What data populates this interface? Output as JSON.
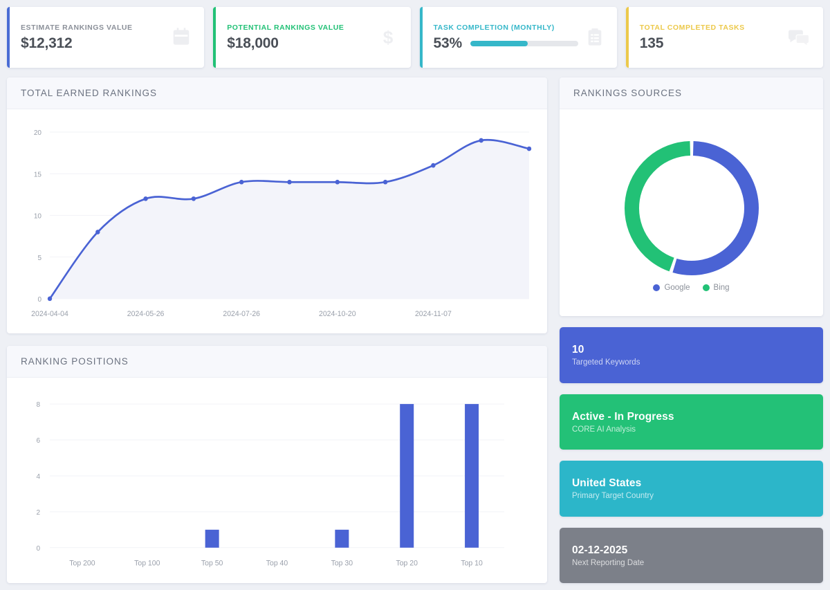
{
  "stats": [
    {
      "label": "ESTIMATE RANKINGS VALUE",
      "value": "$12,312",
      "accent": "#4a6cd4",
      "label_color": "#8b9099",
      "icon": "calendar-icon",
      "type": "value"
    },
    {
      "label": "POTENTIAL RANKINGS VALUE",
      "value": "$18,000",
      "accent": "#22c176",
      "label_color": "#22c176",
      "icon": "dollar-icon",
      "type": "value"
    },
    {
      "label": "TASK COMPLETION (MONTHLY)",
      "value": "53%",
      "accent": "#35b7c9",
      "label_color": "#35b7c9",
      "icon": "clipboard-icon",
      "type": "progress",
      "progress": 53
    },
    {
      "label": "TOTAL COMPLETED TASKS",
      "value": "135",
      "accent": "#ecc94b",
      "label_color": "#ecc94b",
      "icon": "comments-icon",
      "type": "value"
    }
  ],
  "panels": {
    "line_title": "TOTAL EARNED RANKINGS",
    "bar_title": "RANKING POSITIONS",
    "donut_title": "RANKINGS SOURCES"
  },
  "tiles": [
    {
      "value": "10",
      "label": "Targeted Keywords",
      "color": "#4a63d4"
    },
    {
      "value": "Active - In Progress",
      "label": "CORE AI Analysis",
      "color": "#23c177"
    },
    {
      "value": "United States",
      "label": "Primary Target Country",
      "color": "#2cb6c9"
    },
    {
      "value": "02-12-2025",
      "label": "Next Reporting Date",
      "color": "#7c8089"
    }
  ],
  "chart_data": [
    {
      "type": "line",
      "title": "TOTAL EARNED RANKINGS",
      "xlabel": "",
      "ylabel": "",
      "x_tick_labels": [
        "2024-04-04",
        "2024-05-26",
        "2024-07-26",
        "2024-10-20",
        "2024-11-07"
      ],
      "x_tick_indices": [
        0,
        2,
        4,
        6,
        8
      ],
      "y_ticks": [
        0,
        5,
        10,
        15,
        20
      ],
      "ylim": [
        0,
        21
      ],
      "grid": true,
      "area_fill": true,
      "color": "#4a63d4",
      "values": [
        0,
        8,
        12,
        12,
        14,
        14,
        14,
        14,
        16,
        19,
        18
      ],
      "point_count": 11
    },
    {
      "type": "bar",
      "title": "RANKING POSITIONS",
      "categories": [
        "Top 200",
        "Top 100",
        "Top 50",
        "Top 40",
        "Top 30",
        "Top 20",
        "Top 10"
      ],
      "values": [
        0,
        0,
        1,
        0,
        1,
        8,
        8
      ],
      "y_ticks": [
        0,
        2,
        4,
        6,
        8
      ],
      "ylim": [
        0,
        8.6
      ],
      "xlabel": "",
      "ylabel": "",
      "grid": true,
      "color": "#4a63d4"
    },
    {
      "type": "pie",
      "title": "RANKINGS SOURCES",
      "labels": [
        "Google",
        "Bing"
      ],
      "values": [
        55,
        45
      ],
      "colors": [
        "#4a63d4",
        "#22c176"
      ],
      "donut": true,
      "legend_position": "bottom"
    }
  ]
}
